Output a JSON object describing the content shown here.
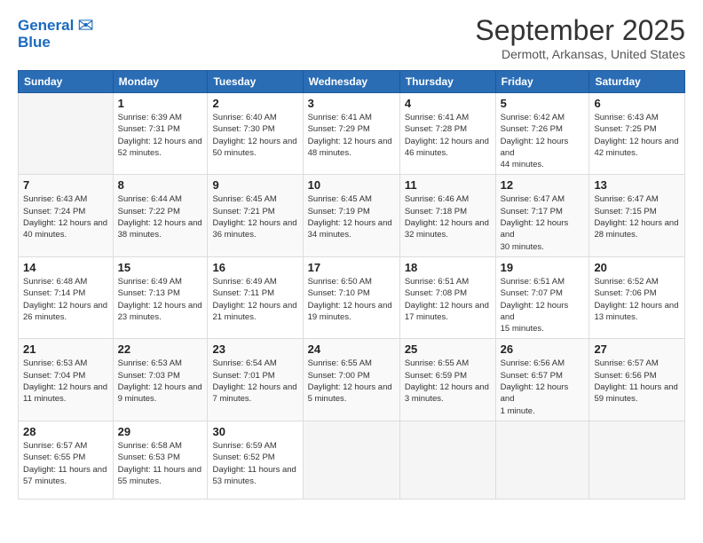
{
  "header": {
    "logo_line1": "General",
    "logo_line2": "Blue",
    "month": "September 2025",
    "location": "Dermott, Arkansas, United States"
  },
  "weekdays": [
    "Sunday",
    "Monday",
    "Tuesday",
    "Wednesday",
    "Thursday",
    "Friday",
    "Saturday"
  ],
  "weeks": [
    [
      {
        "day": "",
        "sunrise": "",
        "sunset": "",
        "daylight": ""
      },
      {
        "day": "1",
        "sunrise": "Sunrise: 6:39 AM",
        "sunset": "Sunset: 7:31 PM",
        "daylight": "Daylight: 12 hours and 52 minutes."
      },
      {
        "day": "2",
        "sunrise": "Sunrise: 6:40 AM",
        "sunset": "Sunset: 7:30 PM",
        "daylight": "Daylight: 12 hours and 50 minutes."
      },
      {
        "day": "3",
        "sunrise": "Sunrise: 6:41 AM",
        "sunset": "Sunset: 7:29 PM",
        "daylight": "Daylight: 12 hours and 48 minutes."
      },
      {
        "day": "4",
        "sunrise": "Sunrise: 6:41 AM",
        "sunset": "Sunset: 7:28 PM",
        "daylight": "Daylight: 12 hours and 46 minutes."
      },
      {
        "day": "5",
        "sunrise": "Sunrise: 6:42 AM",
        "sunset": "Sunset: 7:26 PM",
        "daylight": "Daylight: 12 hours and 44 minutes."
      },
      {
        "day": "6",
        "sunrise": "Sunrise: 6:43 AM",
        "sunset": "Sunset: 7:25 PM",
        "daylight": "Daylight: 12 hours and 42 minutes."
      }
    ],
    [
      {
        "day": "7",
        "sunrise": "Sunrise: 6:43 AM",
        "sunset": "Sunset: 7:24 PM",
        "daylight": "Daylight: 12 hours and 40 minutes."
      },
      {
        "day": "8",
        "sunrise": "Sunrise: 6:44 AM",
        "sunset": "Sunset: 7:22 PM",
        "daylight": "Daylight: 12 hours and 38 minutes."
      },
      {
        "day": "9",
        "sunrise": "Sunrise: 6:45 AM",
        "sunset": "Sunset: 7:21 PM",
        "daylight": "Daylight: 12 hours and 36 minutes."
      },
      {
        "day": "10",
        "sunrise": "Sunrise: 6:45 AM",
        "sunset": "Sunset: 7:19 PM",
        "daylight": "Daylight: 12 hours and 34 minutes."
      },
      {
        "day": "11",
        "sunrise": "Sunrise: 6:46 AM",
        "sunset": "Sunset: 7:18 PM",
        "daylight": "Daylight: 12 hours and 32 minutes."
      },
      {
        "day": "12",
        "sunrise": "Sunrise: 6:47 AM",
        "sunset": "Sunset: 7:17 PM",
        "daylight": "Daylight: 12 hours and 30 minutes."
      },
      {
        "day": "13",
        "sunrise": "Sunrise: 6:47 AM",
        "sunset": "Sunset: 7:15 PM",
        "daylight": "Daylight: 12 hours and 28 minutes."
      }
    ],
    [
      {
        "day": "14",
        "sunrise": "Sunrise: 6:48 AM",
        "sunset": "Sunset: 7:14 PM",
        "daylight": "Daylight: 12 hours and 26 minutes."
      },
      {
        "day": "15",
        "sunrise": "Sunrise: 6:49 AM",
        "sunset": "Sunset: 7:13 PM",
        "daylight": "Daylight: 12 hours and 23 minutes."
      },
      {
        "day": "16",
        "sunrise": "Sunrise: 6:49 AM",
        "sunset": "Sunset: 7:11 PM",
        "daylight": "Daylight: 12 hours and 21 minutes."
      },
      {
        "day": "17",
        "sunrise": "Sunrise: 6:50 AM",
        "sunset": "Sunset: 7:10 PM",
        "daylight": "Daylight: 12 hours and 19 minutes."
      },
      {
        "day": "18",
        "sunrise": "Sunrise: 6:51 AM",
        "sunset": "Sunset: 7:08 PM",
        "daylight": "Daylight: 12 hours and 17 minutes."
      },
      {
        "day": "19",
        "sunrise": "Sunrise: 6:51 AM",
        "sunset": "Sunset: 7:07 PM",
        "daylight": "Daylight: 12 hours and 15 minutes."
      },
      {
        "day": "20",
        "sunrise": "Sunrise: 6:52 AM",
        "sunset": "Sunset: 7:06 PM",
        "daylight": "Daylight: 12 hours and 13 minutes."
      }
    ],
    [
      {
        "day": "21",
        "sunrise": "Sunrise: 6:53 AM",
        "sunset": "Sunset: 7:04 PM",
        "daylight": "Daylight: 12 hours and 11 minutes."
      },
      {
        "day": "22",
        "sunrise": "Sunrise: 6:53 AM",
        "sunset": "Sunset: 7:03 PM",
        "daylight": "Daylight: 12 hours and 9 minutes."
      },
      {
        "day": "23",
        "sunrise": "Sunrise: 6:54 AM",
        "sunset": "Sunset: 7:01 PM",
        "daylight": "Daylight: 12 hours and 7 minutes."
      },
      {
        "day": "24",
        "sunrise": "Sunrise: 6:55 AM",
        "sunset": "Sunset: 7:00 PM",
        "daylight": "Daylight: 12 hours and 5 minutes."
      },
      {
        "day": "25",
        "sunrise": "Sunrise: 6:55 AM",
        "sunset": "Sunset: 6:59 PM",
        "daylight": "Daylight: 12 hours and 3 minutes."
      },
      {
        "day": "26",
        "sunrise": "Sunrise: 6:56 AM",
        "sunset": "Sunset: 6:57 PM",
        "daylight": "Daylight: 12 hours and 1 minute."
      },
      {
        "day": "27",
        "sunrise": "Sunrise: 6:57 AM",
        "sunset": "Sunset: 6:56 PM",
        "daylight": "Daylight: 11 hours and 59 minutes."
      }
    ],
    [
      {
        "day": "28",
        "sunrise": "Sunrise: 6:57 AM",
        "sunset": "Sunset: 6:55 PM",
        "daylight": "Daylight: 11 hours and 57 minutes."
      },
      {
        "day": "29",
        "sunrise": "Sunrise: 6:58 AM",
        "sunset": "Sunset: 6:53 PM",
        "daylight": "Daylight: 11 hours and 55 minutes."
      },
      {
        "day": "30",
        "sunrise": "Sunrise: 6:59 AM",
        "sunset": "Sunset: 6:52 PM",
        "daylight": "Daylight: 11 hours and 53 minutes."
      },
      {
        "day": "",
        "sunrise": "",
        "sunset": "",
        "daylight": ""
      },
      {
        "day": "",
        "sunrise": "",
        "sunset": "",
        "daylight": ""
      },
      {
        "day": "",
        "sunrise": "",
        "sunset": "",
        "daylight": ""
      },
      {
        "day": "",
        "sunrise": "",
        "sunset": "",
        "daylight": ""
      }
    ]
  ]
}
